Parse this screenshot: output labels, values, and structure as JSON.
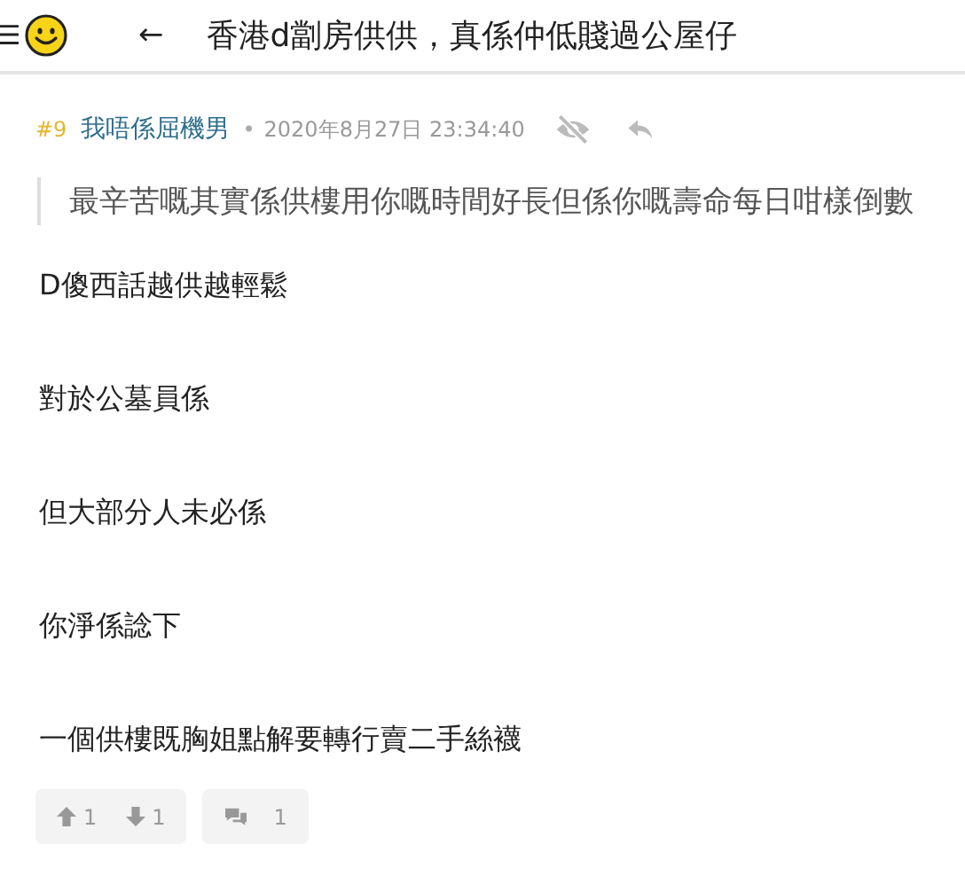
{
  "header": {
    "menu_glyph": "☰",
    "back_glyph": "←",
    "title": "香港d劏房供供，真係仲低賤過公屋仔"
  },
  "post": {
    "number": "#9",
    "author": "我唔係屈機男",
    "separator": "•",
    "time": "2020年8月27日 23:34:40",
    "quote": "最辛苦嘅其實係供樓用你嘅時間好長但係你嘅壽命每日咁樣倒數",
    "paragraphs": [
      "D傻西話越供越輕鬆",
      "對於公墓員係",
      "但大部分人未必係",
      "你淨係諗下",
      "一個供樓既胸姐點解要轉行賣二手絲襪"
    ],
    "upvotes": "1",
    "downvotes": "1",
    "replies": "1"
  }
}
